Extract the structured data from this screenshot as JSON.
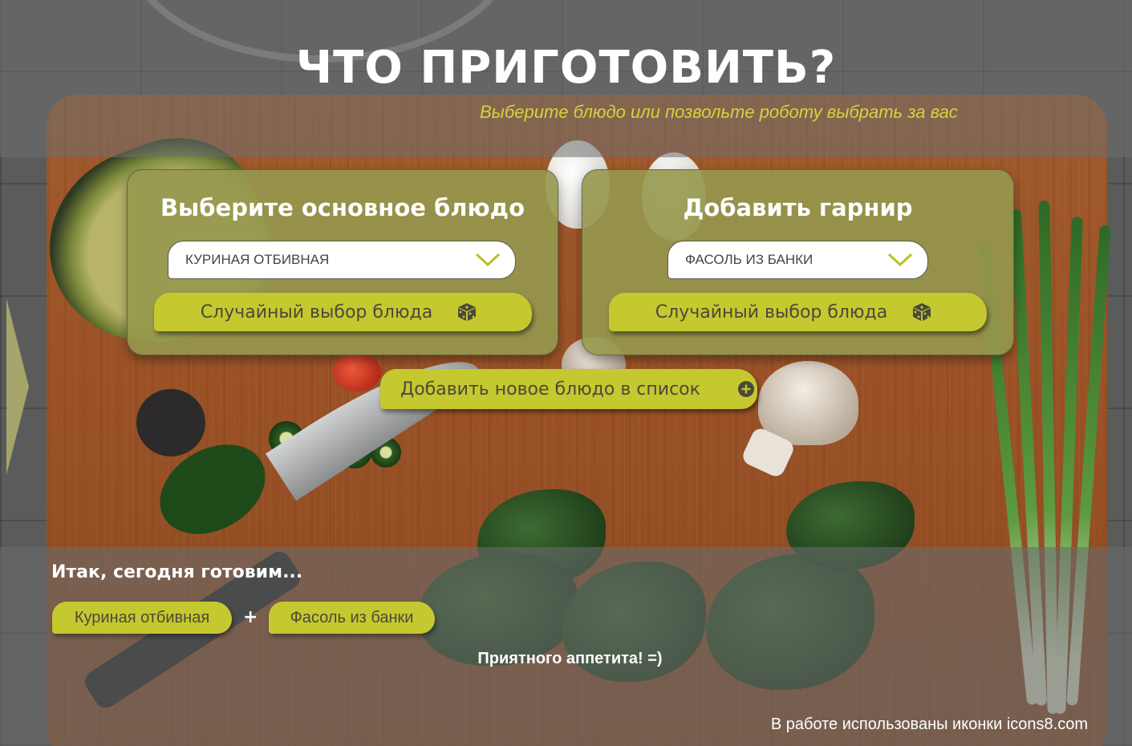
{
  "header": {
    "title": "ЧТО ПРИГОТОВИТЬ?",
    "subtitle": "Выберите блюдо или позвольте роботу выбрать за вас"
  },
  "main_dish": {
    "title": "Выберите основное блюдо",
    "selected": "КУРИНАЯ ОТБИВНАЯ",
    "random_button": "Случайный выбор блюда",
    "icons": {
      "dropdown": "chevron-down-icon",
      "random": "dice-icon"
    }
  },
  "side_dish": {
    "title": "Добавить гарнир",
    "selected": "ФАСОЛЬ ИЗ БАНКИ",
    "random_button": "Случайный выбор блюда",
    "icons": {
      "dropdown": "chevron-down-icon",
      "random": "dice-icon"
    }
  },
  "add_dish": {
    "label": "Добавить новое блюдо в список",
    "icon": "plus-circle-icon"
  },
  "result": {
    "heading": "Итак, сегодня готовим...",
    "main": "Куриная отбивная",
    "plus": "+",
    "side": "Фасоль из банки",
    "wish": "Приятного аппетита! =)"
  },
  "footer": {
    "credits": "В работе использованы иконки icons8.com"
  },
  "colors": {
    "accent": "#c5c82e",
    "subtitle": "#d7d23a",
    "card": "#96984e",
    "chevron": "#b9c023"
  }
}
